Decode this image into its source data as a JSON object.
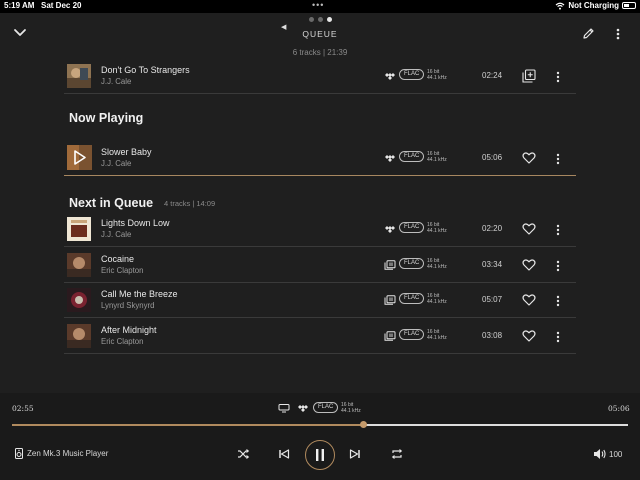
{
  "status_bar": {
    "time": "5:19 AM",
    "date": "Sat Dec 20",
    "dots": "•••",
    "battery_text": "Not Charging"
  },
  "header": {
    "title": "QUEUE",
    "subtitle": "6 tracks | 21:39",
    "page_dots": 3,
    "active_page": 3,
    "icons": [
      "chevron-down-icon",
      "chevron-left-icon",
      "edit-icon",
      "more-icon"
    ]
  },
  "previous": [
    {
      "title": "Don't Go To Strangers",
      "artist": "J.J. Cale",
      "source": "tidal",
      "format": "FLAC",
      "bit_depth": "16 bit",
      "sample_rate": "44.1 kHz",
      "duration": "02:24",
      "action": "add-to-queue-icon"
    }
  ],
  "now_playing": {
    "heading": "Now Playing",
    "track": {
      "title": "Slower Baby",
      "artist": "J.J. Cale",
      "source": "tidal",
      "format": "FLAC",
      "bit_depth": "16 bit",
      "sample_rate": "44.1 kHz",
      "duration": "05:06",
      "action": "heart-icon"
    }
  },
  "next_in_queue": {
    "heading": "Next in Queue",
    "info": "4 tracks | 14:09",
    "tracks": [
      {
        "title": "Lights Down Low",
        "artist": "J.J. Cale",
        "source": "tidal",
        "format": "FLAC",
        "bit_depth": "16 bit",
        "sample_rate": "44.1 kHz",
        "duration": "02:20",
        "action": "heart-icon"
      },
      {
        "title": "Cocaine",
        "artist": "Eric Clapton",
        "source": "library",
        "format": "FLAC",
        "bit_depth": "16 bit",
        "sample_rate": "44.1 kHz",
        "duration": "03:34",
        "action": "heart-icon"
      },
      {
        "title": "Call Me the Breeze",
        "artist": "Lynyrd Skynyrd",
        "source": "library",
        "format": "FLAC",
        "bit_depth": "16 bit",
        "sample_rate": "44.1 kHz",
        "duration": "05:07",
        "action": "heart-icon"
      },
      {
        "title": "After Midnight",
        "artist": "Eric Clapton",
        "source": "library",
        "format": "FLAC",
        "bit_depth": "16 bit",
        "sample_rate": "44.1 kHz",
        "duration": "03:08",
        "action": "heart-icon"
      }
    ]
  },
  "player": {
    "elapsed": "02:55",
    "total": "05:06",
    "progress": 0.57,
    "format": "FLAC",
    "bit_depth": "16 bit",
    "sample_rate": "44.1 kHz",
    "device": "Zen Mk.3 Music Player",
    "volume": "100",
    "state": "playing",
    "icons": [
      "cast-icon",
      "tidal-icon",
      "speaker-icon",
      "shuffle-icon",
      "previous-icon",
      "pause-icon",
      "next-icon",
      "repeat-icon",
      "volume-icon"
    ]
  },
  "colors": {
    "background": "#1f1f1f",
    "accent": "#b08a5e",
    "divider": "#3a3a3a",
    "text": "#e8e8e8",
    "muted": "#9a9a9a"
  }
}
